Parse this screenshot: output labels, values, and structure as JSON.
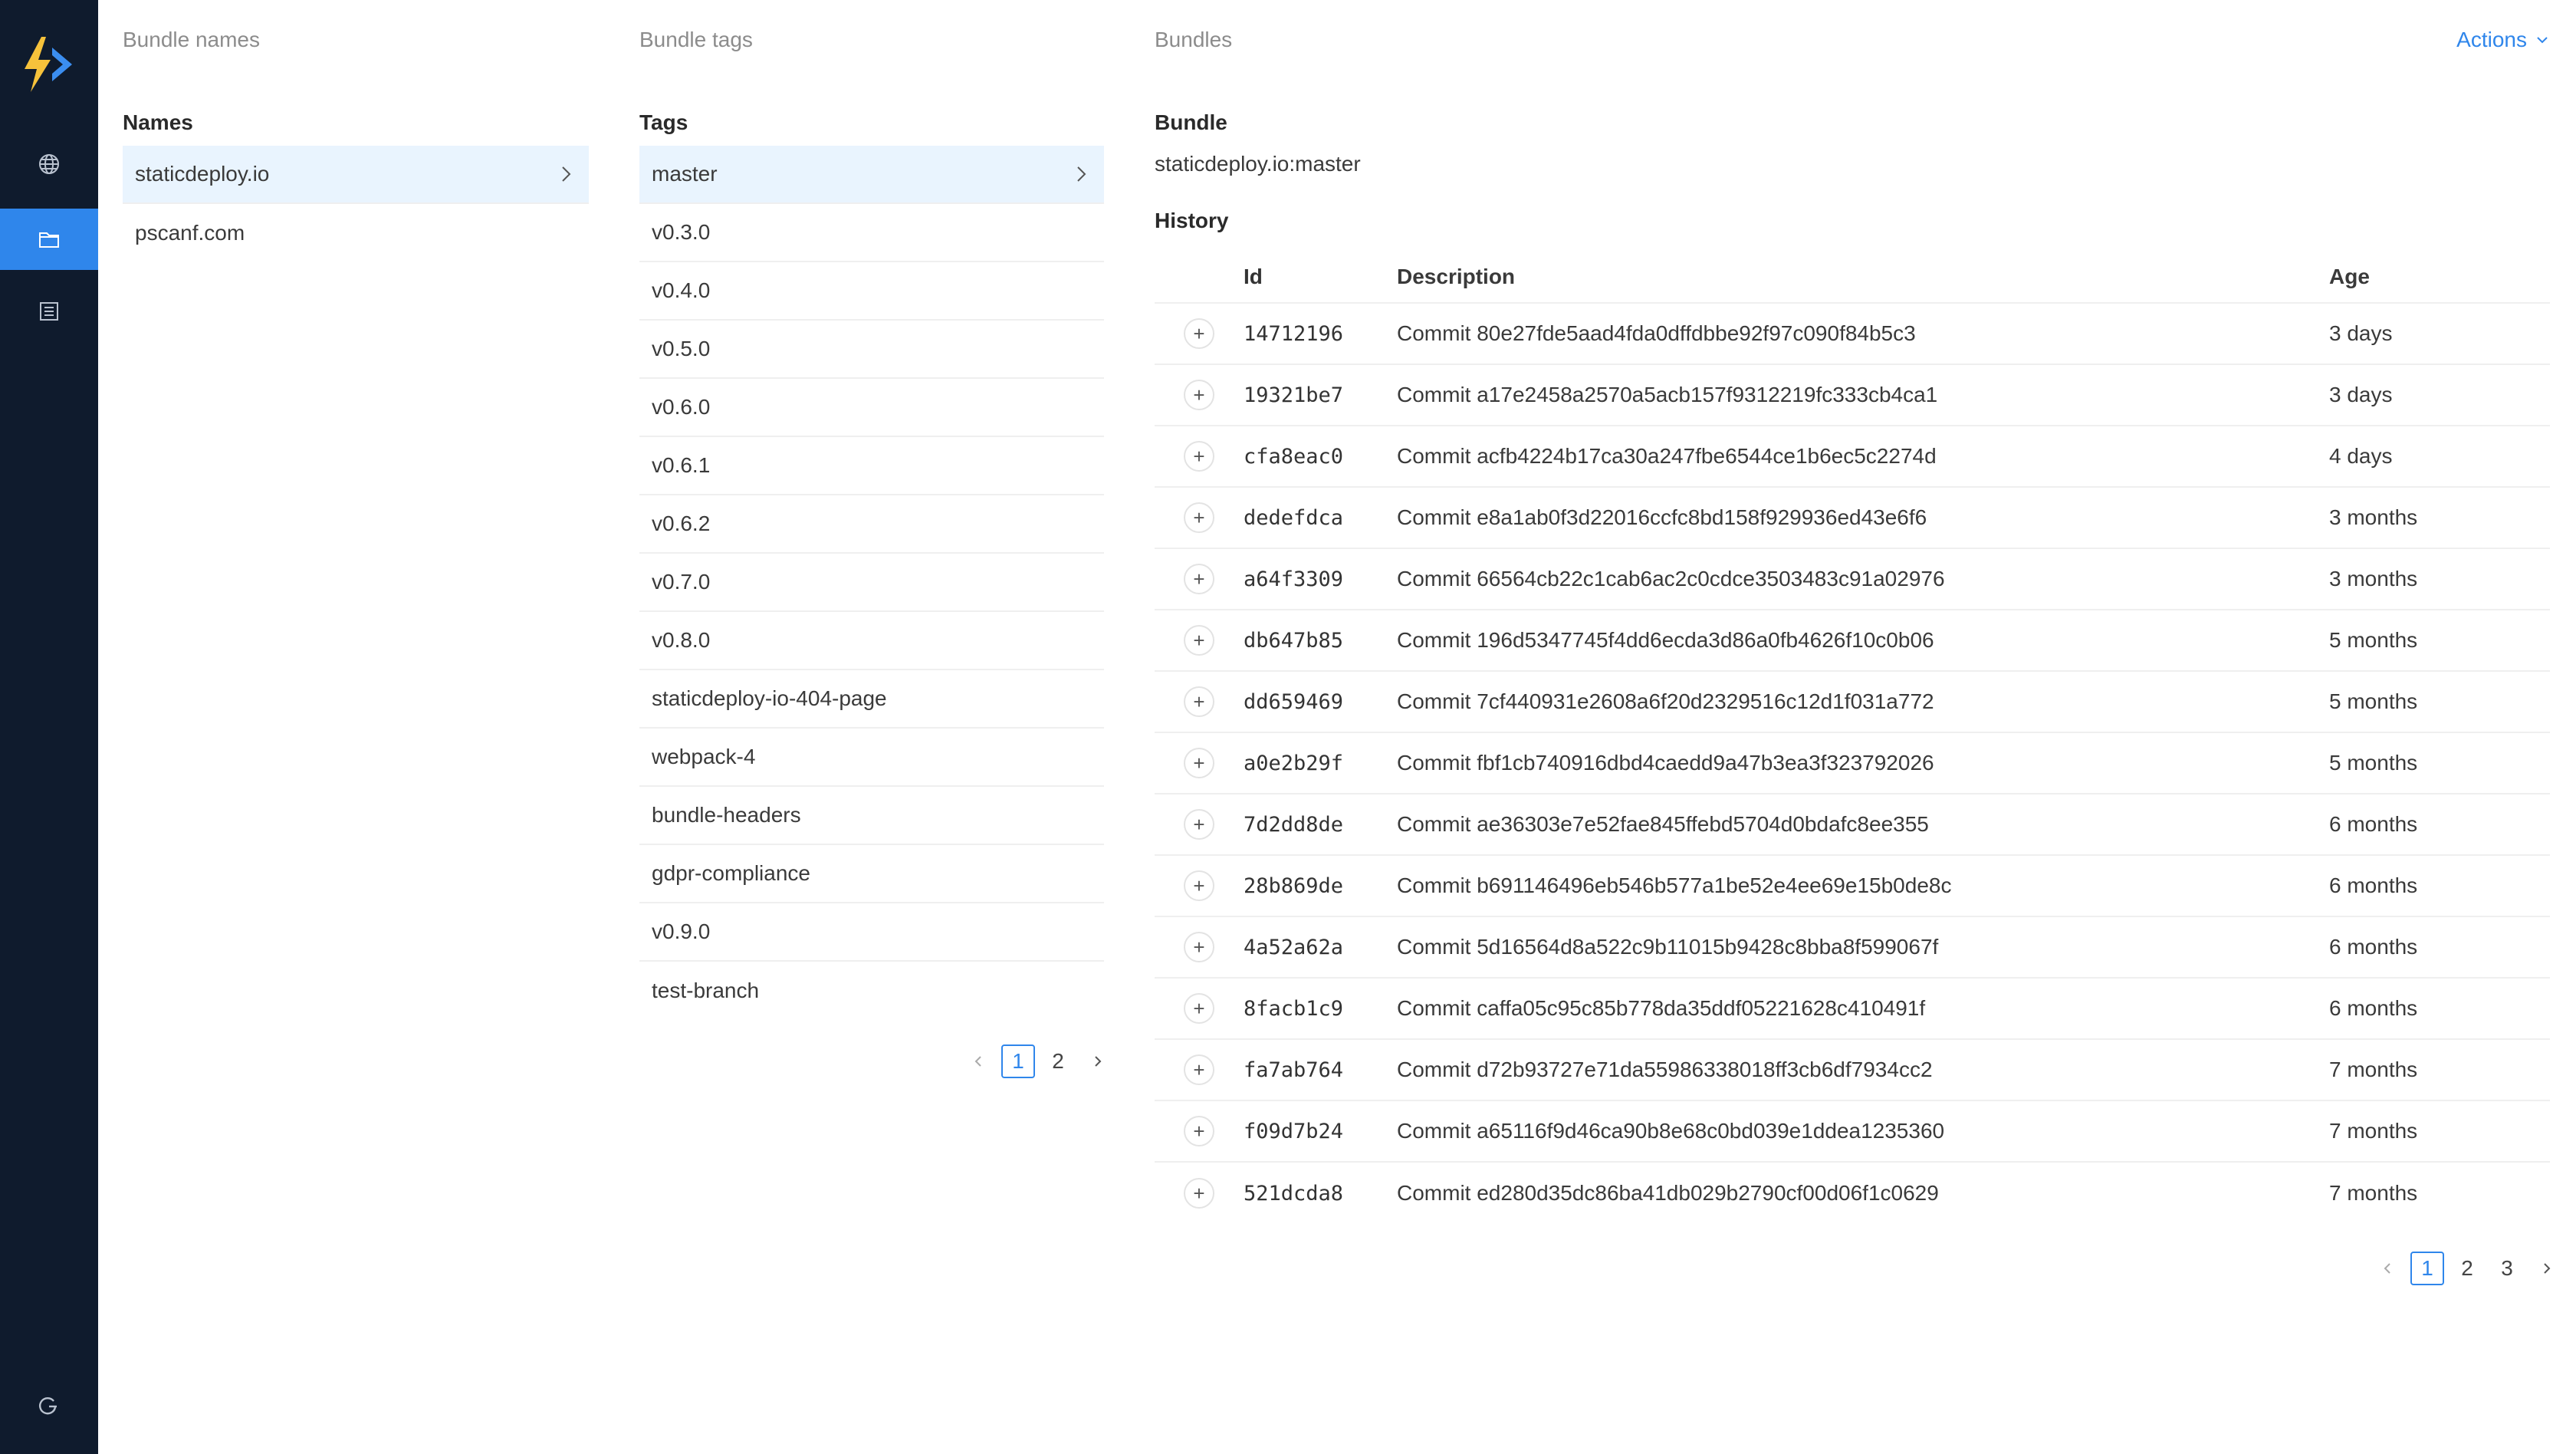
{
  "sidebar": {
    "nav": [
      {
        "icon": "globe-icon"
      },
      {
        "icon": "folder-icon",
        "active": true
      },
      {
        "icon": "list-icon"
      }
    ],
    "logout_icon": "logout-icon",
    "accent": "#2f86eb",
    "bg": "#0f1b2d"
  },
  "columns": {
    "bundle_names_title": "Bundle names",
    "bundle_tags_title": "Bundle tags",
    "bundles_title": "Bundles"
  },
  "actions": {
    "label": "Actions"
  },
  "names": {
    "label": "Names",
    "items": [
      "staticdeploy.io",
      "pscanf.com"
    ],
    "selected": "staticdeploy.io"
  },
  "tags": {
    "label": "Tags",
    "items": [
      "master",
      "v0.3.0",
      "v0.4.0",
      "v0.5.0",
      "v0.6.0",
      "v0.6.1",
      "v0.6.2",
      "v0.7.0",
      "v0.8.0",
      "staticdeploy-io-404-page",
      "webpack-4",
      "bundle-headers",
      "gdpr-compliance",
      "v0.9.0",
      "test-branch"
    ],
    "selected": "master",
    "pagination": {
      "pages": [
        "1",
        "2"
      ],
      "current": "1"
    }
  },
  "bundle": {
    "label": "Bundle",
    "value": "staticdeploy.io:master",
    "history_label": "History",
    "columns": {
      "id": "Id",
      "description": "Description",
      "age": "Age"
    },
    "rows": [
      {
        "id": "14712196",
        "description": "Commit 80e27fde5aad4fda0dffdbbe92f97c090f84b5c3",
        "age": "3 days"
      },
      {
        "id": "19321be7",
        "description": "Commit a17e2458a2570a5acb157f9312219fc333cb4ca1",
        "age": "3 days"
      },
      {
        "id": "cfa8eac0",
        "description": "Commit acfb4224b17ca30a247fbe6544ce1b6ec5c2274d",
        "age": "4 days"
      },
      {
        "id": "dedefdca",
        "description": "Commit e8a1ab0f3d22016ccfc8bd158f929936ed43e6f6",
        "age": "3 months"
      },
      {
        "id": "a64f3309",
        "description": "Commit 66564cb22c1cab6ac2c0cdce3503483c91a02976",
        "age": "3 months"
      },
      {
        "id": "db647b85",
        "description": "Commit 196d5347745f4dd6ecda3d86a0fb4626f10c0b06",
        "age": "5 months"
      },
      {
        "id": "dd659469",
        "description": "Commit 7cf440931e2608a6f20d2329516c12d1f031a772",
        "age": "5 months"
      },
      {
        "id": "a0e2b29f",
        "description": "Commit fbf1cb740916dbd4caedd9a47b3ea3f323792026",
        "age": "5 months"
      },
      {
        "id": "7d2dd8de",
        "description": "Commit ae36303e7e52fae845ffebd5704d0bdafc8ee355",
        "age": "6 months"
      },
      {
        "id": "28b869de",
        "description": "Commit b691146496eb546b577a1be52e4ee69e15b0de8c",
        "age": "6 months"
      },
      {
        "id": "4a52a62a",
        "description": "Commit 5d16564d8a522c9b11015b9428c8bba8f599067f",
        "age": "6 months"
      },
      {
        "id": "8facb1c9",
        "description": "Commit caffa05c95c85b778da35ddf05221628c410491f",
        "age": "6 months"
      },
      {
        "id": "fa7ab764",
        "description": "Commit d72b93727e71da55986338018ff3cb6df7934cc2",
        "age": "7 months"
      },
      {
        "id": "f09d7b24",
        "description": "Commit a65116f9d46ca90b8e68c0bd039e1ddea1235360",
        "age": "7 months"
      },
      {
        "id": "521dcda8",
        "description": "Commit ed280d35dc86ba41db029b2790cf00d06f1c0629",
        "age": "7 months"
      }
    ],
    "pagination": {
      "pages": [
        "1",
        "2",
        "3"
      ],
      "current": "1"
    }
  }
}
